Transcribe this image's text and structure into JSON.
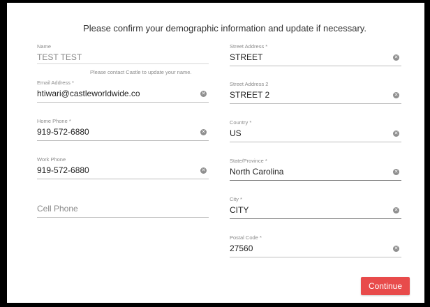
{
  "heading": "Please confirm your demographic information and update if necessary.",
  "left": {
    "name": {
      "label": "Name",
      "value": "TEST  TEST",
      "note": "Please contact Castle to update your name."
    },
    "email": {
      "label": "Email Address *",
      "value": "htiwari@castleworldwide.co"
    },
    "home_phone": {
      "label": "Home Phone *",
      "value": "919-572-6880"
    },
    "work_phone": {
      "label": "Work Phone",
      "value": "919-572-6880"
    },
    "cell_phone": {
      "placeholder": "Cell Phone"
    }
  },
  "right": {
    "street": {
      "label": "Street Address *",
      "value": "STREET"
    },
    "street2": {
      "label": "Street Address 2",
      "value": "STREET 2"
    },
    "country": {
      "label": "Country *",
      "value": "US"
    },
    "state": {
      "label": "State/Province *",
      "value": "North Carolina"
    },
    "city": {
      "label": "City *",
      "value": "CITY"
    },
    "postal": {
      "label": "Postal Code *",
      "value": "27560"
    }
  },
  "clear_icon": "close-circle-icon",
  "clear_glyph": "✕",
  "continue_label": "Continue",
  "colors": {
    "accent": "#e84b4b",
    "frame": "#000000"
  }
}
